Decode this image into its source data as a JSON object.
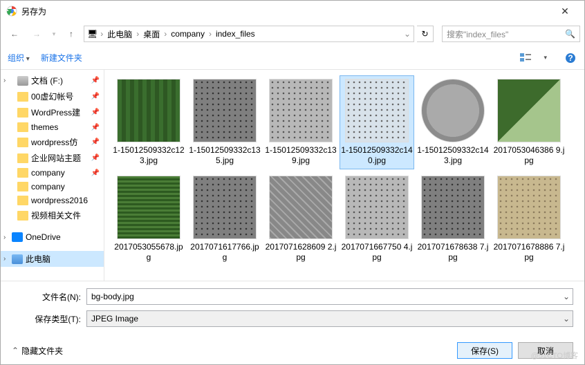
{
  "title": "另存为",
  "nav": {
    "back": "←",
    "forward": "→",
    "up": "↑"
  },
  "breadcrumb": {
    "root_icon": "🖥",
    "items": [
      "此电脑",
      "桌面",
      "company",
      "index_files"
    ]
  },
  "search": {
    "placeholder": "搜索\"index_files\""
  },
  "toolbar": {
    "organize": "组织",
    "new_folder": "新建文件夹"
  },
  "sidebar": {
    "items": [
      {
        "label": "文档 (F:)",
        "type": "drive",
        "pin": true,
        "exp": ">"
      },
      {
        "label": "00虚幻帐号",
        "type": "folder",
        "pin": true
      },
      {
        "label": "WordPress建",
        "type": "folder",
        "pin": true
      },
      {
        "label": "themes",
        "type": "folder",
        "pin": true
      },
      {
        "label": "wordpress仿",
        "type": "folder",
        "pin": true
      },
      {
        "label": "企业网站主题",
        "type": "folder",
        "pin": true
      },
      {
        "label": "company",
        "type": "folder",
        "pin": true
      },
      {
        "label": "company",
        "type": "folder"
      },
      {
        "label": "wordpress2016",
        "type": "folder"
      },
      {
        "label": "视频相关文件",
        "type": "folder"
      }
    ],
    "onedrive": "OneDrive",
    "pc": "此电脑"
  },
  "files": {
    "items": [
      {
        "name": "1-15012509332c123.jpg",
        "tex": "tex-green-roll"
      },
      {
        "name": "1-15012509332c135.jpg",
        "tex": "tex-perf-dark"
      },
      {
        "name": "1-15012509332c139.jpg",
        "tex": "tex-perf-light"
      },
      {
        "name": "1-15012509332c140.jpg",
        "tex": "tex-perf-blue",
        "selected": true
      },
      {
        "name": "1-15012509332c143.jpg",
        "tex": "tex-round"
      },
      {
        "name": "2017053046386 9.jpg",
        "tex": "tex-green-fence"
      },
      {
        "name": "2017053055678.jpg",
        "tex": "tex-green-mesh"
      },
      {
        "name": "2017071617766.jpg",
        "tex": "tex-perf-dark"
      },
      {
        "name": "2017071628609 2.jpg",
        "tex": "tex-grid-diag"
      },
      {
        "name": "2017071667750 4.jpg",
        "tex": "tex-perf-light"
      },
      {
        "name": "2017071678638 7.jpg",
        "tex": "tex-perf-dark"
      },
      {
        "name": "2017071678886 7.jpg",
        "tex": "tex-beige-perf"
      }
    ]
  },
  "form": {
    "filename_label": "文件名(N):",
    "filename_value": "bg-body.jpg",
    "filetype_label": "保存类型(T):",
    "filetype_value": "JPEG Image"
  },
  "footer": {
    "hide_folders": "隐藏文件夹",
    "save": "保存(S)",
    "cancel": "取消"
  },
  "watermark": "@51CTO博客"
}
